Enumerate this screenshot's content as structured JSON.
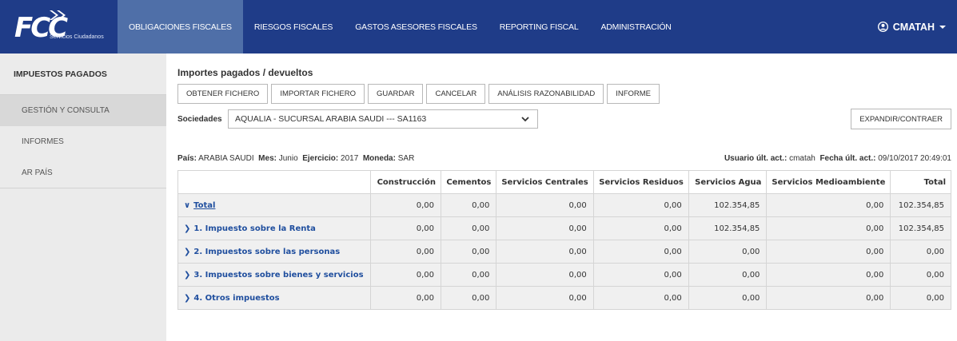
{
  "header": {
    "logo_text": "FCC",
    "logo_subtitle": "Servicios Ciudadanos",
    "nav": [
      {
        "label": "OBLIGACIONES FISCALES",
        "active": true
      },
      {
        "label": "RIESGOS FISCALES",
        "active": false
      },
      {
        "label": "GASTOS ASESORES FISCALES",
        "active": false
      },
      {
        "label": "REPORTING FISCAL",
        "active": false
      },
      {
        "label": "ADMINISTRACIÓN",
        "active": false
      }
    ],
    "user": "CMATAH",
    "user_icon": "user-circle-icon",
    "user_dropdown_icon": "caret-down-icon"
  },
  "sidebar": {
    "title": "IMPUESTOS PAGADOS",
    "items": [
      {
        "label": "GESTIÓN Y CONSULTA",
        "active": true
      },
      {
        "label": "INFORMES",
        "active": false
      },
      {
        "label": "AR PAÍS",
        "active": false
      }
    ]
  },
  "main": {
    "title": "Importes pagados / devueltos",
    "toolbar": [
      "OBTENER FICHERO",
      "IMPORTAR FICHERO",
      "GUARDAR",
      "CANCELAR",
      "ANÁLISIS RAZONABILIDAD",
      "INFORME"
    ],
    "sociedades_label": "Sociedades",
    "sociedades_value": "AQUALIA - SUCURSAL ARABIA SAUDI --- SA1163",
    "expand_label": "EXPANDIR/CONTRAER",
    "meta": {
      "pais_label": "País:",
      "pais": "ARABIA SAUDI",
      "mes_label": "Mes:",
      "mes": "Junio",
      "ejercicio_label": "Ejercicio:",
      "ejercicio": "2017",
      "moneda_label": "Moneda:",
      "moneda": "SAR",
      "usuario_label": "Usuario últ. act.:",
      "usuario": "cmatah",
      "fecha_label": "Fecha últ. act.:",
      "fecha": "09/10/2017 20:49:01"
    }
  },
  "table": {
    "columns": [
      "",
      "Construcción",
      "Cementos",
      "Servicios Centrales",
      "Servicios Residuos",
      "Servicios Agua",
      "Servicios Medioambiente",
      "Total"
    ],
    "rows": [
      {
        "label": "Total",
        "expanded": true,
        "values": [
          "0,00",
          "0,00",
          "0,00",
          "0,00",
          "102.354,85",
          "0,00",
          "102.354,85"
        ]
      },
      {
        "label": "1. Impuesto sobre la Renta",
        "expanded": false,
        "values": [
          "0,00",
          "0,00",
          "0,00",
          "0,00",
          "102.354,85",
          "0,00",
          "102.354,85"
        ]
      },
      {
        "label": "2. Impuestos sobre las personas",
        "expanded": false,
        "values": [
          "0,00",
          "0,00",
          "0,00",
          "0,00",
          "0,00",
          "0,00",
          "0,00"
        ]
      },
      {
        "label": "3. Impuestos sobre bienes y servicios",
        "expanded": false,
        "values": [
          "0,00",
          "0,00",
          "0,00",
          "0,00",
          "0,00",
          "0,00",
          "0,00"
        ]
      },
      {
        "label": "4. Otros impuestos",
        "expanded": false,
        "values": [
          "0,00",
          "0,00",
          "0,00",
          "0,00",
          "0,00",
          "0,00",
          "0,00"
        ]
      }
    ]
  }
}
